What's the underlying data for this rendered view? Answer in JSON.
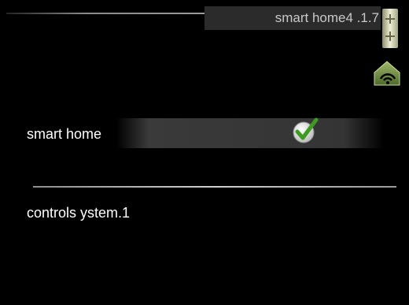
{
  "header": {
    "title": "smart home4 .1.7"
  },
  "icons": {
    "scroll_indicator": "scroll-position-icon",
    "house": "house-wifi-icon",
    "check": "checkmark-icon"
  },
  "colors": {
    "background": "#000000",
    "title_bar": "#2b2b2b",
    "title_text": "#c8c8c8",
    "check_green": "#4caf2a",
    "house_green": "#6b8a3a"
  },
  "menu": {
    "items": [
      {
        "label": "smart home",
        "checked": true
      }
    ]
  },
  "submenu": {
    "label": "controls ystem.1"
  }
}
